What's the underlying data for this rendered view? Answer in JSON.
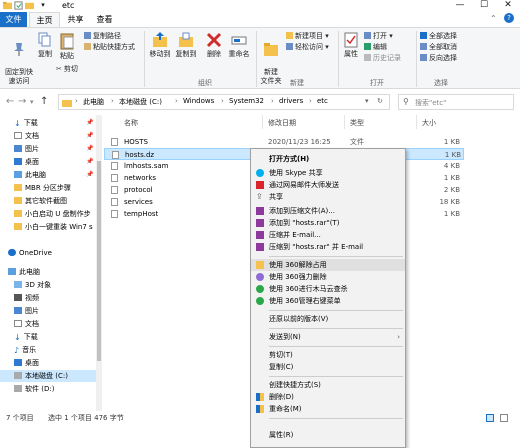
{
  "window": {
    "title": "etc",
    "minimize": "—",
    "maximize": "☐",
    "close": "✕"
  },
  "tabs": {
    "file": "文件",
    "home": "主页",
    "share": "共享",
    "view": "查看"
  },
  "ribbon": {
    "pin_quick": "固定到快\n速访问",
    "copy": "复制",
    "paste": "粘贴",
    "copy_path": "复制路径",
    "paste_shortcut": "粘贴快捷方式",
    "cut": "剪切",
    "move_to": "移动到",
    "copy_to": "复制到",
    "delete": "删除",
    "rename": "重命名",
    "new_folder": "新建\n文件夹",
    "new_item": "新建项目 ▾",
    "easy_access": "轻松访问 ▾",
    "properties": "属性",
    "open": "打开 ▾",
    "edit": "编辑",
    "history": "历史记录",
    "select_all": "全部选择",
    "select_none": "全部取消",
    "invert_select": "反向选择",
    "group_organize": "组织",
    "group_new": "新建",
    "group_open": "打开",
    "group_select": "选择"
  },
  "address": {
    "crumbs": [
      "此电脑",
      "本地磁盘 (C:)",
      "Windows",
      "System32",
      "drivers",
      "etc"
    ],
    "separator": "›",
    "search_placeholder": "搜索\"etc\""
  },
  "nav": {
    "items": [
      {
        "label": "下载",
        "pinned": true
      },
      {
        "label": "文档",
        "pinned": true
      },
      {
        "label": "图片",
        "pinned": true
      },
      {
        "label": "桌面",
        "pinned": true
      },
      {
        "label": "此电脑",
        "pinned": true
      },
      {
        "label": "MBR 分区步骤"
      },
      {
        "label": "其它软件截图"
      },
      {
        "label": "小白启动 U 盘制作步"
      },
      {
        "label": "小白一键重装 Win7 s"
      },
      {
        "label": ""
      },
      {
        "label": "OneDrive"
      },
      {
        "label": ""
      },
      {
        "label": "此电脑"
      },
      {
        "label": "3D 对象"
      },
      {
        "label": "视频"
      },
      {
        "label": "图片"
      },
      {
        "label": "文档"
      },
      {
        "label": "下载"
      },
      {
        "label": "音乐"
      },
      {
        "label": "桌面"
      },
      {
        "label": "本地磁盘 (C:)"
      },
      {
        "label": "软件 (D:)"
      }
    ]
  },
  "list": {
    "headers": {
      "name": "名称",
      "date": "修改日期",
      "type": "类型",
      "size": "大小"
    },
    "rows": [
      {
        "name": "HOSTS",
        "date": "2020/11/23 16:25",
        "type": "文件",
        "size": "1 KB"
      },
      {
        "name": "hosts.dz",
        "date": "",
        "type": "",
        "size": "1 KB"
      },
      {
        "name": "lmhosts.sam",
        "date": "",
        "type": "",
        "size": "4 KB"
      },
      {
        "name": "networks",
        "date": "",
        "type": "",
        "size": "1 KB"
      },
      {
        "name": "protocol",
        "date": "",
        "type": "",
        "size": "2 KB"
      },
      {
        "name": "services",
        "date": "",
        "type": "",
        "size": "18 KB"
      },
      {
        "name": "tempHost",
        "date": "",
        "type": "",
        "size": "1 KB"
      }
    ]
  },
  "context_menu": {
    "items": [
      {
        "label": "打开方式(H)",
        "bold": true
      },
      {
        "label": "使用 Skype 共享",
        "icon": "skype"
      },
      {
        "label": "通过网易邮件大师发送",
        "icon": "mail"
      },
      {
        "label": "共享",
        "icon": "share"
      },
      {
        "label": "添加到压缩文件(A)...",
        "icon": "rar"
      },
      {
        "label": "添加到 \"hosts.rar\"(T)",
        "icon": "rar"
      },
      {
        "label": "压缩并 E-mail...",
        "icon": "rar"
      },
      {
        "label": "压缩到 \"hosts.rar\" 并 E-mail",
        "icon": "rar"
      },
      {
        "label": "使用 360解除占用",
        "icon": "360a"
      },
      {
        "label": "使用 360强力删除",
        "icon": "360b"
      },
      {
        "label": "使用 360进行木马云查杀",
        "icon": "360c"
      },
      {
        "label": "使用 360管理右键菜单",
        "icon": "360c"
      },
      {
        "label": "还原以前的版本(V)"
      },
      {
        "label": "发送到(N)",
        "submenu": true
      },
      {
        "label": "剪切(T)"
      },
      {
        "label": "复制(C)"
      },
      {
        "label": "创建快捷方式(S)"
      },
      {
        "label": "删除(D)",
        "icon": "shield"
      },
      {
        "label": "重命名(M)",
        "icon": "shield"
      },
      {
        "label": "属性(R)"
      }
    ]
  },
  "status": {
    "count": "7 个项目",
    "selected": "选中 1 个项目 476 字节"
  },
  "colors": {
    "accent": "#1a6fc9",
    "selection": "#cce8ff",
    "folder": "#f3c14c"
  }
}
